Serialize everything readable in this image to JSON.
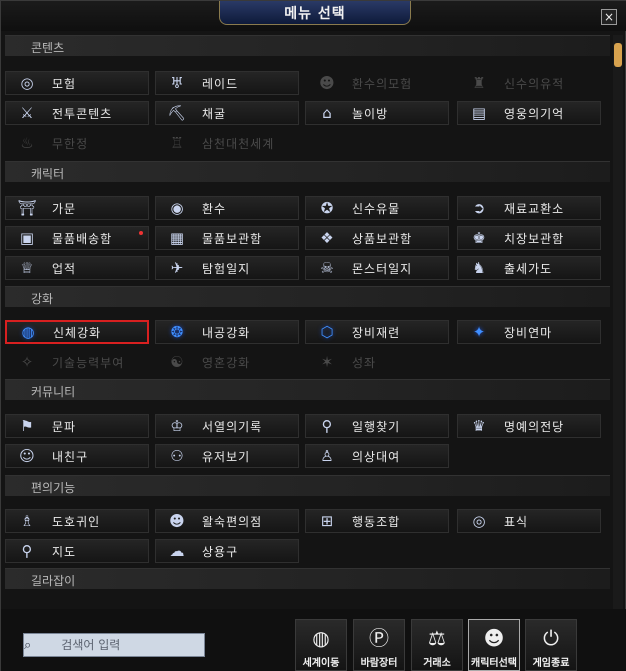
{
  "window": {
    "title": "메뉴 선택",
    "ornament": "❦",
    "close_label": "×"
  },
  "sections": {
    "content": {
      "title": "콘텐츠",
      "items": [
        {
          "label": "모험",
          "icon": "adventure-icon",
          "glyph": "◎",
          "disabled": false
        },
        {
          "label": "레이드",
          "icon": "raid-icon",
          "glyph": "♅",
          "disabled": false
        },
        {
          "label": "환수의모험",
          "icon": "spirit-adventure-icon",
          "glyph": "☻",
          "disabled": true
        },
        {
          "label": "신수의유적",
          "icon": "relic-icon",
          "glyph": "♜",
          "disabled": true
        },
        {
          "label": "전투콘텐츠",
          "icon": "crossed-swords-icon",
          "glyph": "⚔",
          "disabled": false
        },
        {
          "label": "채굴",
          "icon": "mining-icon",
          "glyph": "⛏",
          "disabled": false
        },
        {
          "label": "놀이방",
          "icon": "playroom-icon",
          "glyph": "⌂",
          "disabled": false
        },
        {
          "label": "영웅의기억",
          "icon": "hero-memory-icon",
          "glyph": "▤",
          "disabled": false
        },
        {
          "label": "무한정",
          "icon": "infinite-icon",
          "glyph": "♨",
          "disabled": true
        },
        {
          "label": "삼천대천세계",
          "icon": "world-tower-icon",
          "glyph": "♖",
          "disabled": true
        }
      ]
    },
    "character": {
      "title": "캐릭터",
      "items": [
        {
          "label": "가문",
          "icon": "family-icon",
          "glyph": "⛩",
          "disabled": false,
          "dot": false
        },
        {
          "label": "환수",
          "icon": "spirit-beast-icon",
          "glyph": "◉",
          "disabled": false,
          "dot": false
        },
        {
          "label": "신수유물",
          "icon": "divine-relic-icon",
          "glyph": "✪",
          "disabled": false,
          "dot": false
        },
        {
          "label": "재료교환소",
          "icon": "exchange-icon",
          "glyph": "➲",
          "disabled": false,
          "dot": false
        },
        {
          "label": "물품배송함",
          "icon": "delivery-box-icon",
          "glyph": "▣",
          "disabled": false,
          "dot": true
        },
        {
          "label": "물품보관함",
          "icon": "storage-chest-icon",
          "glyph": "▦",
          "disabled": false,
          "dot": false
        },
        {
          "label": "상품보관함",
          "icon": "product-storage-icon",
          "glyph": "❖",
          "disabled": false,
          "dot": false
        },
        {
          "label": "치장보관함",
          "icon": "costume-storage-icon",
          "glyph": "♚",
          "disabled": false,
          "dot": false
        },
        {
          "label": "업적",
          "icon": "achievement-icon",
          "glyph": "♕",
          "disabled": false,
          "dot": false
        },
        {
          "label": "탐험일지",
          "icon": "exploration-log-icon",
          "glyph": "✈",
          "disabled": false,
          "dot": false
        },
        {
          "label": "몬스터일지",
          "icon": "monster-log-icon",
          "glyph": "☠",
          "disabled": false,
          "dot": false
        },
        {
          "label": "출세가도",
          "icon": "success-path-icon",
          "glyph": "♞",
          "disabled": false,
          "dot": false
        }
      ]
    },
    "enhance": {
      "title": "강화",
      "items": [
        {
          "label": "신체강화",
          "icon": "body-enhance-icon",
          "glyph": "◍",
          "disabled": false,
          "selected": true
        },
        {
          "label": "내공강화",
          "icon": "inner-power-icon",
          "glyph": "❂",
          "disabled": false,
          "selected": false
        },
        {
          "label": "장비재련",
          "icon": "equipment-refine-icon",
          "glyph": "⬡",
          "disabled": false,
          "selected": false
        },
        {
          "label": "장비연마",
          "icon": "equipment-polish-icon",
          "glyph": "✦",
          "disabled": false,
          "selected": false
        },
        {
          "label": "기술능력부여",
          "icon": "skill-grant-icon",
          "glyph": "✧",
          "disabled": true,
          "selected": false
        },
        {
          "label": "영혼강화",
          "icon": "soul-enhance-icon",
          "glyph": "☯",
          "disabled": true,
          "selected": false
        },
        {
          "label": "성좌",
          "icon": "constellation-icon",
          "glyph": "✶",
          "disabled": true,
          "selected": false
        }
      ]
    },
    "community": {
      "title": "커뮤니티",
      "items": [
        {
          "label": "문파",
          "icon": "guild-icon",
          "glyph": "⚑",
          "disabled": false
        },
        {
          "label": "서열의기록",
          "icon": "ranking-icon",
          "glyph": "♔",
          "disabled": false
        },
        {
          "label": "일행찾기",
          "icon": "party-search-icon",
          "glyph": "⚲",
          "disabled": false
        },
        {
          "label": "명예의전당",
          "icon": "hall-of-fame-icon",
          "glyph": "♛",
          "disabled": false
        },
        {
          "label": "내친구",
          "icon": "friends-icon",
          "glyph": "☺",
          "disabled": false
        },
        {
          "label": "유저보기",
          "icon": "user-view-icon",
          "glyph": "⚇",
          "disabled": false
        },
        {
          "label": "의상대여",
          "icon": "costume-rental-icon",
          "glyph": "♙",
          "disabled": false
        }
      ]
    },
    "convenience": {
      "title": "편의기능",
      "items": [
        {
          "label": "도호귀인",
          "icon": "noble-icon",
          "glyph": "♗",
          "disabled": false
        },
        {
          "label": "왈숙편의점",
          "icon": "convenience-store-icon",
          "glyph": "☻",
          "disabled": false
        },
        {
          "label": "행동조합",
          "icon": "action-combo-icon",
          "glyph": "⊞",
          "disabled": false
        },
        {
          "label": "표식",
          "icon": "marker-icon",
          "glyph": "◎",
          "disabled": false
        },
        {
          "label": "지도",
          "icon": "map-pin-icon",
          "glyph": "⚲",
          "disabled": false
        },
        {
          "label": "상용구",
          "icon": "chat-phrase-icon",
          "glyph": "☁",
          "disabled": false
        }
      ]
    },
    "guide": {
      "title": "길라잡이"
    }
  },
  "search": {
    "placeholder": "검색어 입력"
  },
  "footer": {
    "buttons": [
      {
        "label": "세계이동",
        "icon": "globe-icon",
        "glyph": "◍",
        "active": false
      },
      {
        "label": "바람장터",
        "icon": "p-coin-icon",
        "glyph": "Ⓟ",
        "active": false
      },
      {
        "label": "거래소",
        "icon": "scales-icon",
        "glyph": "⚖",
        "active": false
      },
      {
        "label": "캐릭터선택",
        "icon": "character-select-icon",
        "glyph": "☻",
        "active": true
      },
      {
        "label": "게임종료",
        "icon": "power-icon",
        "glyph": "⏻",
        "active": false
      }
    ]
  },
  "colors": {
    "accent_blue": "#3f8fff",
    "selection_red": "#d82020",
    "scroll_thumb": "#d7a24e"
  }
}
